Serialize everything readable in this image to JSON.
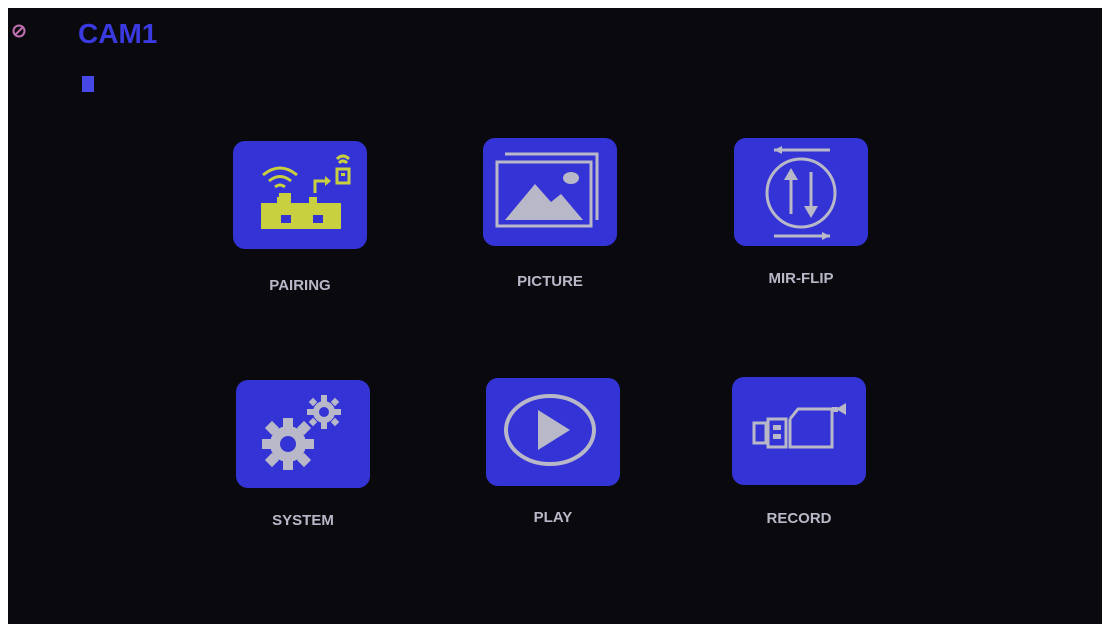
{
  "header": {
    "title": "CAM1"
  },
  "icons": {
    "status": "edit-circle-icon",
    "signal": "signal-bar-icon"
  },
  "menu": [
    {
      "label": "PAIRING",
      "icon": "pairing-icon"
    },
    {
      "label": "PICTURE",
      "icon": "picture-icon"
    },
    {
      "label": "MIR-FLIP",
      "icon": "mirror-flip-icon"
    },
    {
      "label": "SYSTEM",
      "icon": "gears-icon"
    },
    {
      "label": "PLAY",
      "icon": "play-icon"
    },
    {
      "label": "RECORD",
      "icon": "video-camera-icon"
    }
  ],
  "colors": {
    "tile": "#3434d6",
    "title": "#3a3ae0",
    "label": "#b8b8c8",
    "background": "#0a0a0e",
    "pairing_accent": "#c8d040"
  }
}
